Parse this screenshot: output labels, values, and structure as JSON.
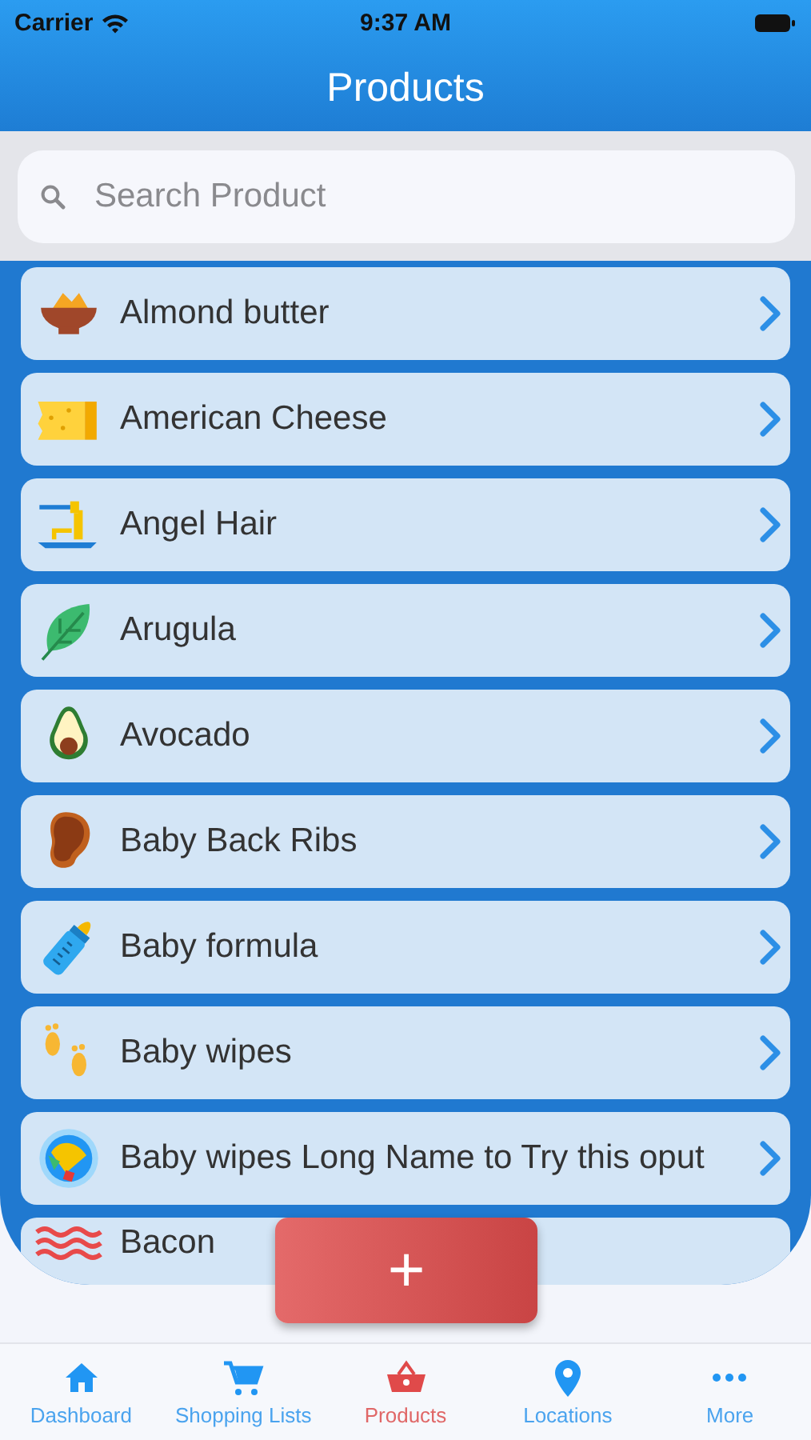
{
  "status_bar": {
    "carrier": "Carrier",
    "time": "9:37 AM"
  },
  "header": {
    "title": "Products"
  },
  "search": {
    "placeholder": "Search Product"
  },
  "products": [
    {
      "name": "Almond butter"
    },
    {
      "name": "American Cheese"
    },
    {
      "name": "Angel Hair"
    },
    {
      "name": "Arugula"
    },
    {
      "name": "Avocado"
    },
    {
      "name": "Baby Back Ribs"
    },
    {
      "name": "Baby formula"
    },
    {
      "name": "Baby wipes"
    },
    {
      "name": "Baby wipes Long Name to Try this oput"
    },
    {
      "name": "Bacon"
    }
  ],
  "add_button": {
    "label": "+"
  },
  "tabs": [
    {
      "label": "Dashboard",
      "selected": false
    },
    {
      "label": "Shopping Lists",
      "selected": false
    },
    {
      "label": "Products",
      "selected": true
    },
    {
      "label": "Locations",
      "selected": false
    },
    {
      "label": "More",
      "selected": false
    }
  ]
}
